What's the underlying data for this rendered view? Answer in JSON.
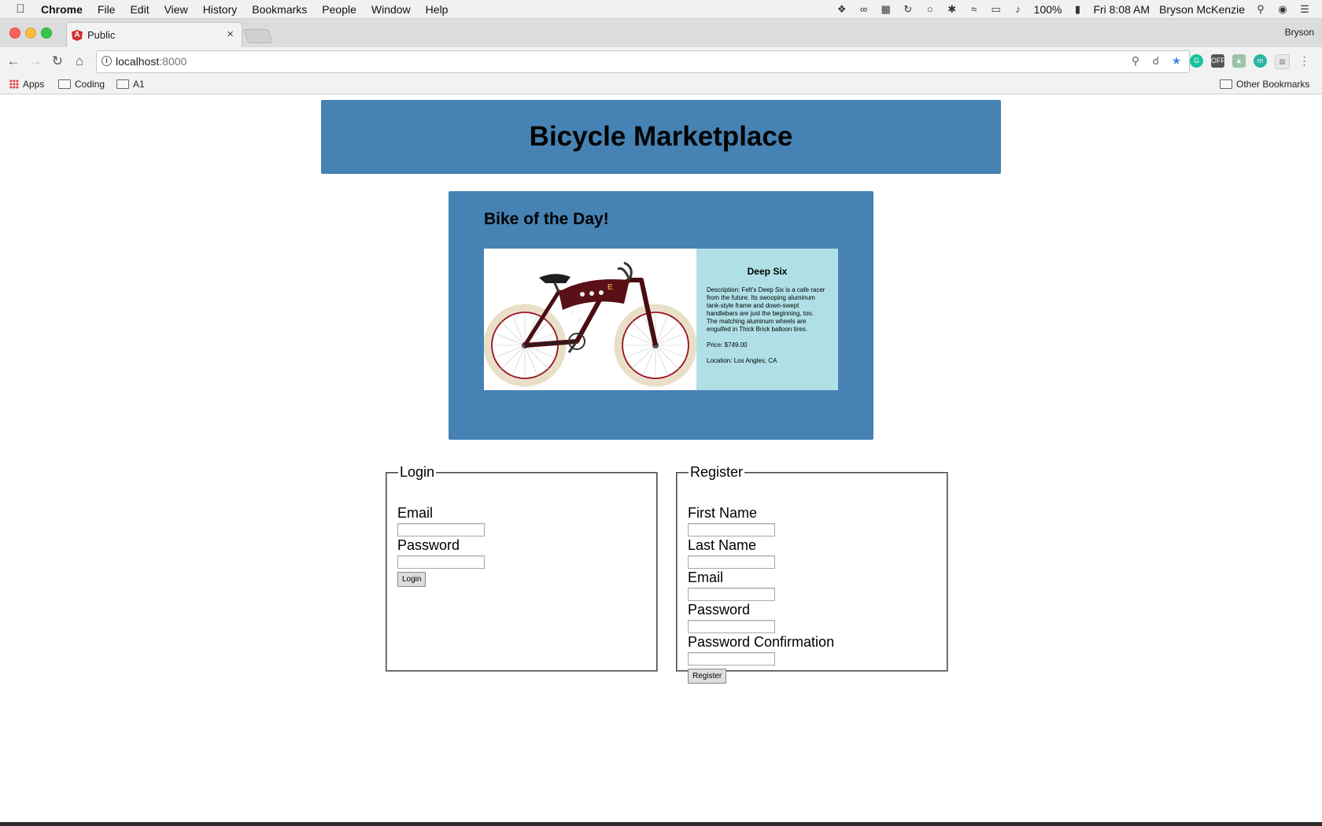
{
  "menubar": {
    "app": "Chrome",
    "items": [
      "File",
      "Edit",
      "View",
      "History",
      "Bookmarks",
      "People",
      "Window",
      "Help"
    ],
    "battery": "100%",
    "clock": "Fri 8:08 AM",
    "user": "Bryson McKenzie"
  },
  "browser": {
    "tab_title": "Public",
    "profile": "Bryson",
    "url_host": "localhost",
    "url_port": ":8000",
    "bookmarks": [
      "Apps",
      "Coding",
      "A1"
    ],
    "other_bookmarks": "Other Bookmarks"
  },
  "page": {
    "title": "Bicycle Marketplace",
    "featured": {
      "heading": "Bike of the Day!",
      "name": "Deep Six",
      "description": "Description: Felt's Deep Six is a cafe racer from the future. Its swooping aluminum tank-style frame and down-swept handlebars are just the beginning, too. The matching aluminum wheels are engulfed in Thick Brick balloon tires.",
      "price": "Price: $749.00",
      "location": "Location: Los Angles, CA"
    },
    "login": {
      "legend": "Login",
      "email_label": "Email",
      "password_label": "Password",
      "button": "Login"
    },
    "register": {
      "legend": "Register",
      "first_name_label": "First Name",
      "last_name_label": "Last Name",
      "email_label": "Email",
      "password_label": "Password",
      "confirm_label": "Password Confirmation",
      "button": "Register"
    }
  }
}
